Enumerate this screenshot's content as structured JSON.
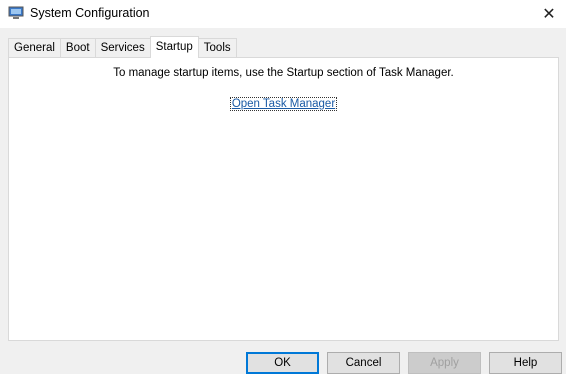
{
  "window": {
    "title": "System Configuration",
    "icon": "system-config-icon",
    "close_glyph": "✕"
  },
  "tabs": [
    {
      "label": "General"
    },
    {
      "label": "Boot"
    },
    {
      "label": "Services"
    },
    {
      "label": "Startup",
      "active": true
    },
    {
      "label": "Tools"
    }
  ],
  "panel": {
    "message": "To manage startup items, use the Startup section of Task Manager.",
    "link_label": "Open Task Manager"
  },
  "buttons": {
    "ok": "OK",
    "cancel": "Cancel",
    "apply": "Apply",
    "help": "Help"
  },
  "colors": {
    "link": "#1a5aa5",
    "default_button_border": "#0078d7"
  }
}
